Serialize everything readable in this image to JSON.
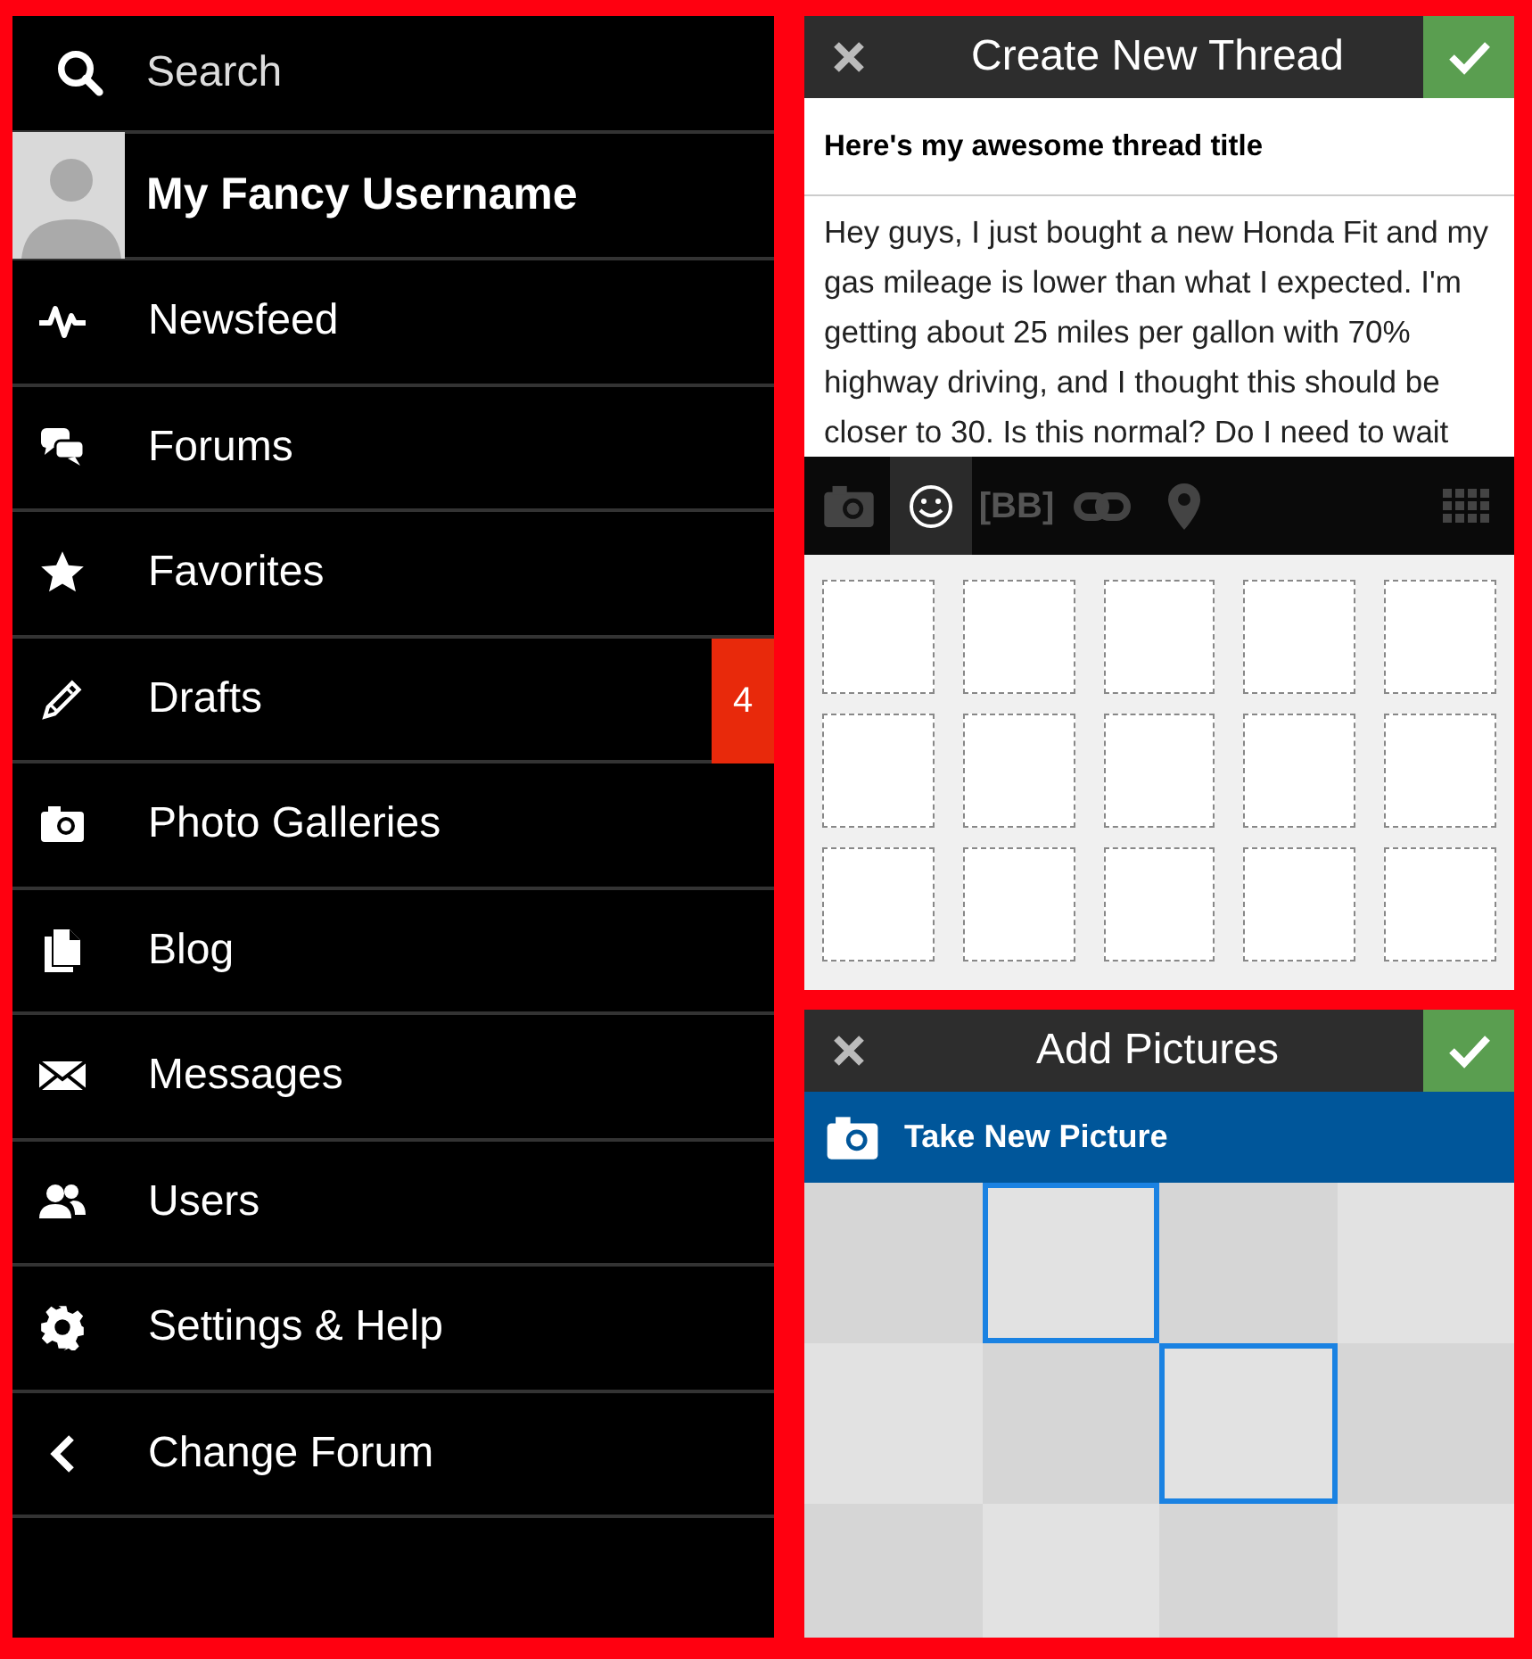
{
  "menu": {
    "search": {
      "placeholder": "Search"
    },
    "user": {
      "name": "My Fancy Username"
    },
    "items": [
      {
        "kind": "pulse",
        "label": "Newsfeed"
      },
      {
        "kind": "chat",
        "label": "Forums"
      },
      {
        "kind": "star",
        "label": "Favorites"
      },
      {
        "kind": "pencil",
        "label": "Drafts",
        "badge": "4"
      },
      {
        "kind": "camera",
        "label": "Photo Galleries"
      },
      {
        "kind": "pages",
        "label": "Blog"
      },
      {
        "kind": "mail",
        "label": "Messages"
      },
      {
        "kind": "users",
        "label": "Users"
      },
      {
        "kind": "gear",
        "label": "Settings & Help"
      },
      {
        "kind": "back",
        "label": "Change Forum"
      }
    ]
  },
  "thread": {
    "title": "Create New Thread",
    "thread_title": {
      "value": "Here's my awesome thread title"
    },
    "body": {
      "value": "Hey guys, I just bought a new Honda Fit and my gas mileage is lower than what I expected. I'm getting about 25 miles per gallon with 70% highway driving, and I thought this should be closer to 30. Is this normal? Do I need to wait"
    },
    "tools": [
      {
        "kind": "camera",
        "selected": false
      },
      {
        "kind": "smiley",
        "selected": true
      },
      {
        "kind": "text",
        "label": "[BB]",
        "selected": false
      },
      {
        "kind": "link",
        "selected": false
      },
      {
        "kind": "pin",
        "selected": false
      },
      {
        "kind": "keyboard",
        "selected": false
      }
    ]
  },
  "pictures": {
    "title": "Add Pictures",
    "take_button": "Take New Picture",
    "tiles": [
      {
        "selected": false
      },
      {
        "selected": true
      },
      {
        "selected": false
      },
      {
        "selected": false
      },
      {
        "selected": false
      },
      {
        "selected": false
      },
      {
        "selected": true
      },
      {
        "selected": false
      },
      {
        "selected": false
      },
      {
        "selected": false
      },
      {
        "selected": false
      },
      {
        "selected": false
      }
    ]
  }
}
